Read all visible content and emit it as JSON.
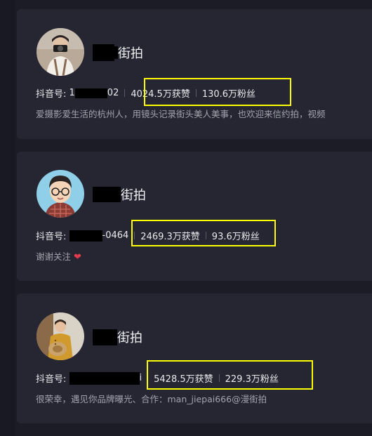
{
  "accent_colors": {
    "highlight": "#ffff00",
    "heart": "#e23b4a"
  },
  "cards": [
    {
      "name_suffix": "街拍",
      "id_label": "抖音号: ",
      "id_visible_start": "1",
      "id_visible_end": "02",
      "likes": "4024.5万获赞",
      "fans": "130.6万粉丝",
      "bio": "爱摄影爱生活的杭州人，用镜头记录街头美人美事，也欢迎来信约拍，视频"
    },
    {
      "name_suffix": "街拍",
      "id_label": "抖音号: ",
      "id_visible_start": "",
      "id_visible_end": "-0464",
      "likes": "2469.3万获赞",
      "fans": "93.6万粉丝",
      "bio": "谢谢关注",
      "bio_icon": "heart-icon"
    },
    {
      "name_suffix": "街拍",
      "id_label": "抖音号: ",
      "id_visible_start": "",
      "id_visible_end": "i",
      "likes": "5428.5万获赞",
      "fans": "229.3万粉丝",
      "bio": "很荣幸，遇见你品牌曝光、合作：man_jiepai666@漫街拍"
    }
  ]
}
